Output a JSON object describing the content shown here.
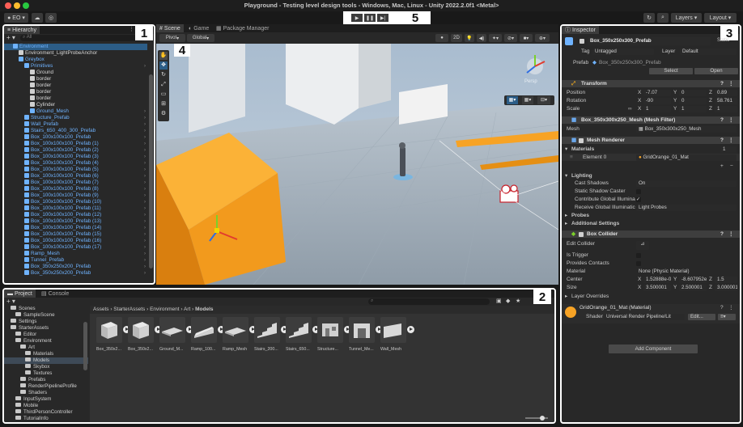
{
  "window": {
    "title": "Playground - Testing level design tools - Windows, Mac, Linux - Unity 2022.2.0f1 <Metal>"
  },
  "toolbar": {
    "account_label": "EO",
    "layers_label": "Layers",
    "layout_label": "Layout"
  },
  "callouts": [
    "1",
    "2",
    "3",
    "4",
    "5"
  ],
  "hierarchy": {
    "tab_label": "Hierarchy",
    "search_placeholder": "All",
    "items": [
      {
        "label": "Environment",
        "indent": 1,
        "color": "blue"
      },
      {
        "label": "Environment_LightProbeAnchor",
        "indent": 2,
        "color": "white"
      },
      {
        "label": "Greybox",
        "indent": 2,
        "color": "blue"
      },
      {
        "label": "Primitives",
        "indent": 3,
        "color": "blue"
      },
      {
        "label": "Ground",
        "indent": 4,
        "color": "white"
      },
      {
        "label": "border",
        "indent": 4,
        "color": "white"
      },
      {
        "label": "border",
        "indent": 4,
        "color": "white"
      },
      {
        "label": "border",
        "indent": 4,
        "color": "white"
      },
      {
        "label": "border",
        "indent": 4,
        "color": "white"
      },
      {
        "label": "Cylinder",
        "indent": 4,
        "color": "white"
      },
      {
        "label": "Ground_Mesh",
        "indent": 4,
        "color": "blue"
      },
      {
        "label": "Structure_Prefab",
        "indent": 3,
        "color": "blue"
      },
      {
        "label": "Wall_Prefab",
        "indent": 3,
        "color": "blue"
      },
      {
        "label": "Stairs_650_400_300_Prefab",
        "indent": 3,
        "color": "blue"
      },
      {
        "label": "Box_100x100x100_Prefab",
        "indent": 3,
        "color": "blue"
      },
      {
        "label": "Box_100x100x100_Prefab (1)",
        "indent": 3,
        "color": "blue"
      },
      {
        "label": "Box_100x100x100_Prefab (2)",
        "indent": 3,
        "color": "blue"
      },
      {
        "label": "Box_100x100x100_Prefab (3)",
        "indent": 3,
        "color": "blue"
      },
      {
        "label": "Box_100x100x100_Prefab (4)",
        "indent": 3,
        "color": "blue"
      },
      {
        "label": "Box_100x100x100_Prefab (5)",
        "indent": 3,
        "color": "blue"
      },
      {
        "label": "Box_100x100x100_Prefab (6)",
        "indent": 3,
        "color": "blue"
      },
      {
        "label": "Box_100x100x100_Prefab (7)",
        "indent": 3,
        "color": "blue"
      },
      {
        "label": "Box_100x100x100_Prefab (8)",
        "indent": 3,
        "color": "blue"
      },
      {
        "label": "Box_100x100x100_Prefab (9)",
        "indent": 3,
        "color": "blue"
      },
      {
        "label": "Box_100x100x100_Prefab (10)",
        "indent": 3,
        "color": "blue"
      },
      {
        "label": "Box_100x100x100_Prefab (11)",
        "indent": 3,
        "color": "blue"
      },
      {
        "label": "Box_100x100x100_Prefab (12)",
        "indent": 3,
        "color": "blue"
      },
      {
        "label": "Box_100x100x100_Prefab (13)",
        "indent": 3,
        "color": "blue"
      },
      {
        "label": "Box_100x100x100_Prefab (14)",
        "indent": 3,
        "color": "blue"
      },
      {
        "label": "Box_100x100x100_Prefab (15)",
        "indent": 3,
        "color": "blue"
      },
      {
        "label": "Box_100x100x100_Prefab (16)",
        "indent": 3,
        "color": "blue"
      },
      {
        "label": "Box_100x100x100_Prefab (17)",
        "indent": 3,
        "color": "blue"
      },
      {
        "label": "Ramp_Mesh",
        "indent": 3,
        "color": "blue"
      },
      {
        "label": "Tunnel_Prefab",
        "indent": 3,
        "color": "blue"
      },
      {
        "label": "Box_350x250x200_Prefab",
        "indent": 3,
        "color": "blue"
      },
      {
        "label": "Box_350x250x200_Prefab",
        "indent": 3,
        "color": "blue"
      }
    ]
  },
  "scene": {
    "tabs": [
      "Scene",
      "Game",
      "Package Manager"
    ],
    "pivot_label": "Pivot",
    "global_label": "Global",
    "mode_2d": "2D",
    "persp_label": "Persp"
  },
  "project": {
    "tabs": [
      "Project",
      "Console"
    ],
    "tree": [
      {
        "label": "Scenes",
        "indent": 1
      },
      {
        "label": "SampleScene",
        "indent": 2
      },
      {
        "label": "Settings",
        "indent": 1
      },
      {
        "label": "StarterAssets",
        "indent": 1
      },
      {
        "label": "Editor",
        "indent": 2
      },
      {
        "label": "Environment",
        "indent": 2
      },
      {
        "label": "Art",
        "indent": 3
      },
      {
        "label": "Materials",
        "indent": 4
      },
      {
        "label": "Models",
        "indent": 4
      },
      {
        "label": "Skybox",
        "indent": 4
      },
      {
        "label": "Textures",
        "indent": 4
      },
      {
        "label": "Prefabs",
        "indent": 3
      },
      {
        "label": "RenderPipelineProfile",
        "indent": 3
      },
      {
        "label": "Shaders",
        "indent": 3
      },
      {
        "label": "InputSystem",
        "indent": 2
      },
      {
        "label": "Mobile",
        "indent": 2
      },
      {
        "label": "ThirdPersonController",
        "indent": 2
      },
      {
        "label": "TutorialInfo",
        "indent": 2
      }
    ],
    "breadcrumb": [
      "Assets",
      "StarterAssets",
      "Environment",
      "Art",
      "Models"
    ],
    "assets": [
      "Box_350x2...",
      "Box_350x2...",
      "Ground_M...",
      "Ramp_100...",
      "Ramp_Mesh",
      "Stairs_200...",
      "Stairs_650...",
      "Structure...",
      "Tunnel_Me...",
      "Wall_Mesh"
    ]
  },
  "inspector": {
    "tab_label": "Inspector",
    "object_name": "Box_350x250x300_Prefab",
    "static_label": "Static",
    "tag_label": "Tag",
    "tag_value": "Untagged",
    "layer_label": "Layer",
    "layer_value": "Default",
    "prefab_label": "Prefab",
    "prefab_value": "Box_350x250x300_Prefab",
    "select_label": "Select",
    "open_label": "Open",
    "transform": {
      "title": "Transform",
      "position_label": "Position",
      "rotation_label": "Rotation",
      "scale_label": "Scale",
      "position": {
        "x": "-7.07",
        "y": "0",
        "z": "0.89"
      },
      "rotation": {
        "x": "-90",
        "y": "0",
        "z": "58.761"
      },
      "scale": {
        "x": "1",
        "y": "1",
        "z": "1"
      }
    },
    "mesh_filter": {
      "title": "Box_350x300x250_Mesh (Mesh Filter)",
      "mesh_label": "Mesh",
      "mesh_value": "Box_350x300x250_Mesh"
    },
    "mesh_renderer": {
      "title": "Mesh Renderer",
      "materials_label": "Materials",
      "materials_count": "1",
      "element_label": "Element 0",
      "element_value": "GridOrange_01_Mat",
      "lighting_label": "Lighting",
      "cast_shadows_label": "Cast Shadows",
      "cast_shadows_value": "On",
      "static_shadow_label": "Static Shadow Caster",
      "contribute_gi_label": "Contribute Global Illumina",
      "receive_gi_label": "Receive Global Illuminatic",
      "receive_gi_value": "Light Probes",
      "probes_label": "Probes",
      "additional_label": "Additional Settings"
    },
    "box_collider": {
      "title": "Box Collider",
      "edit_label": "Edit Collider",
      "trigger_label": "Is Trigger",
      "contacts_label": "Provides Contacts",
      "material_label": "Material",
      "material_value": "None (Physic Material)",
      "center_label": "Center",
      "center": {
        "x": "1.52888e-0",
        "y": "-8.607952e",
        "z": "1.5"
      },
      "size_label": "Size",
      "size": {
        "x": "3.500001",
        "y": "2.500001",
        "z": "3.000001"
      },
      "overrides_label": "Layer Overrides"
    },
    "material": {
      "title": "GridOrange_01_Mat (Material)",
      "shader_label": "Shader",
      "shader_value": "Universal Render Pipeline/Lit",
      "edit_label": "Edit..."
    },
    "add_component_label": "Add Component"
  },
  "colors": {
    "accent_orange": "#f7a325",
    "selection_blue": "#2c5d87",
    "sky_top": "#a7b9cf",
    "callout_white": "#ffffff"
  }
}
